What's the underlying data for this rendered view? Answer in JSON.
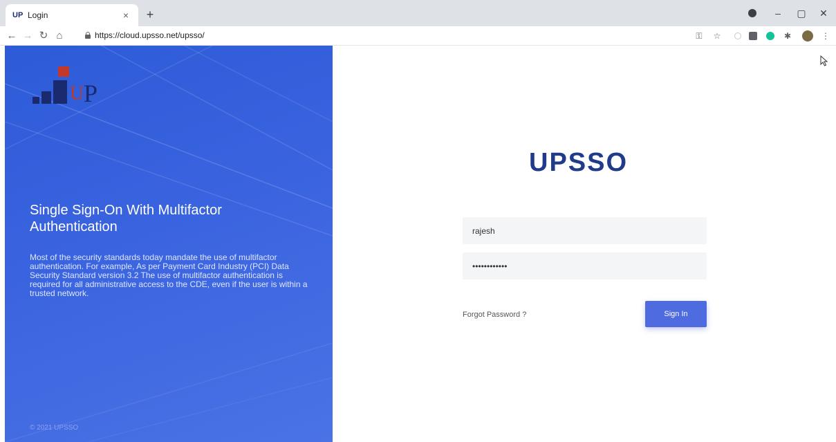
{
  "browser": {
    "tab_favicon": "UP",
    "tab_title": "Login",
    "tab_close": "×",
    "new_tab": "+",
    "url": "https://cloud.upsso.net/upsso/",
    "win_minimize": "–",
    "win_restore": "▢",
    "win_close": "✕"
  },
  "hero": {
    "title": "Single Sign-On With Multifactor Authentication",
    "text": "Most of the security standards today mandate the use of multifactor authentication. For example, As per Payment Card Industry (PCI) Data Security Standard version 3.2 The use of multifactor authentication is required for all administrative access to the CDE, even if the user is within a trusted network.",
    "footer": "© 2021 UPSSO",
    "logo_u": "U",
    "logo_p": "P"
  },
  "login": {
    "brand": "UPSSO",
    "username_value": "rajesh",
    "password_value": "••••••••••••",
    "forgot_label": "Forgot Password ?",
    "signin_label": "Sign In"
  },
  "colors": {
    "hero_blue": "#3a63df",
    "brand_navy": "#1f3b8a",
    "button_blue": "#4f6be0",
    "logo_red": "#c0392b"
  }
}
